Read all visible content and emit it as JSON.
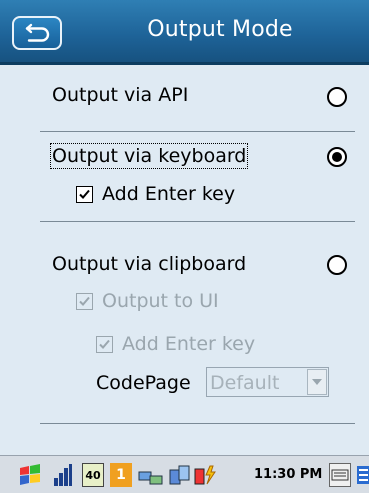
{
  "window": {
    "title": "Output Mode"
  },
  "options": {
    "api_label": "Output via API",
    "keyboard_label": "Output via keyboard",
    "keyboard_add_enter_label": "Add Enter key",
    "clipboard_label": "Output via clipboard",
    "clipboard_output_ui_label": "Output to UI",
    "clipboard_add_enter_label": "Add Enter key",
    "codepage_label": "CodePage",
    "codepage_value": "Default",
    "selected": "keyboard"
  },
  "taskbar": {
    "clock": "11:30 PM",
    "battery_badge": "40",
    "number_badge": "1"
  },
  "colors": {
    "title_bar": "#1e6398",
    "content_bg": "#dfeaf3",
    "disabled_text": "#9aa6ae"
  }
}
